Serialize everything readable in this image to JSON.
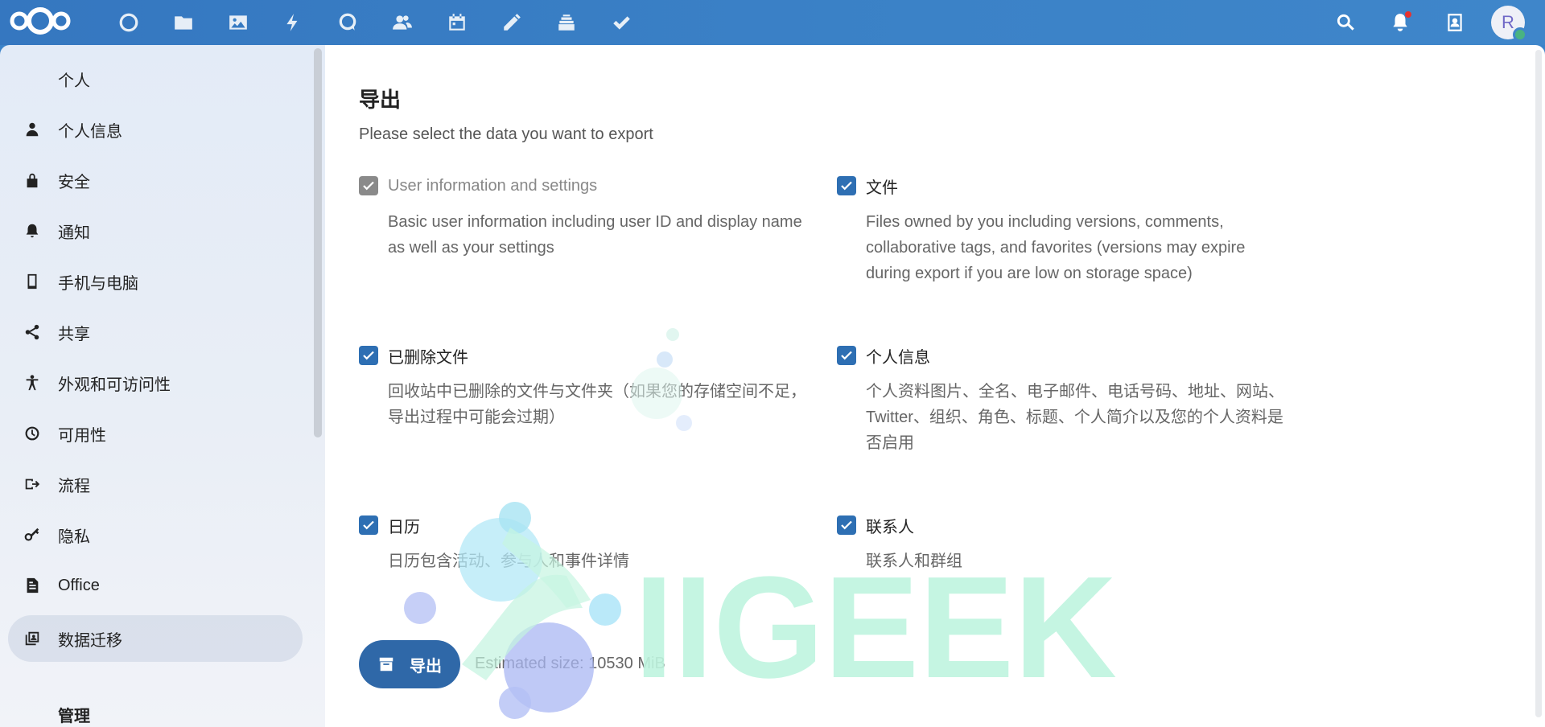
{
  "header": {
    "apps": [
      {
        "name": "dashboard-icon"
      },
      {
        "name": "files-icon"
      },
      {
        "name": "photos-icon"
      },
      {
        "name": "activity-icon"
      },
      {
        "name": "talk-icon"
      },
      {
        "name": "contacts-icon"
      },
      {
        "name": "calendar-icon"
      },
      {
        "name": "notes-icon"
      },
      {
        "name": "deck-icon"
      },
      {
        "name": "tasks-icon"
      }
    ],
    "avatar_initial": "R"
  },
  "sidebar": {
    "section_personal": "个人",
    "items": [
      {
        "label": "个人信息",
        "icon": "person-icon"
      },
      {
        "label": "安全",
        "icon": "lock-icon"
      },
      {
        "label": "通知",
        "icon": "bell-icon"
      },
      {
        "label": "手机与电脑",
        "icon": "phone-icon"
      },
      {
        "label": "共享",
        "icon": "share-icon"
      },
      {
        "label": "外观和可访问性",
        "icon": "accessibility-icon"
      },
      {
        "label": "可用性",
        "icon": "clock-icon"
      },
      {
        "label": "流程",
        "icon": "flow-icon"
      },
      {
        "label": "隐私",
        "icon": "key-icon"
      },
      {
        "label": "Office",
        "icon": "document-icon"
      },
      {
        "label": "数据迁移",
        "icon": "migration-icon",
        "active": true
      }
    ],
    "section_admin": "管理"
  },
  "main": {
    "title": "导出",
    "description": "Please select the data you want to export",
    "options": [
      {
        "label": "User information and settings",
        "desc": "Basic user information including user ID and display name as well as your settings",
        "checked": true,
        "disabled": true
      },
      {
        "label": "文件",
        "desc": "Files owned by you including versions, comments, collaborative tags, and favorites (versions may expire during export if you are low on storage space)",
        "checked": true,
        "disabled": false
      },
      {
        "label": "已删除文件",
        "desc": "回收站中已删除的文件与文件夹（如果您的存储空间不足，导出过程中可能会过期）",
        "checked": true,
        "disabled": false
      },
      {
        "label": "个人信息",
        "desc": "个人资料图片、全名、电子邮件、电话号码、地址、网站、Twitter、组织、角色、标题、个人简介以及您的个人资料是否启用",
        "checked": true,
        "disabled": false
      },
      {
        "label": "日历",
        "desc": "日历包含活动、参与人和事件详情",
        "checked": true,
        "disabled": false
      },
      {
        "label": "联系人",
        "desc": "联系人和群组",
        "checked": true,
        "disabled": false
      }
    ],
    "export_label": "导出",
    "estimated_size": "Estimated size: 10530 MiB"
  },
  "watermark_text": "IIGEEK",
  "colors": {
    "header": "#3b82c7",
    "primary": "#2f68a8",
    "checkbox": "#2e6fb3",
    "watermark": "#bff5df"
  }
}
